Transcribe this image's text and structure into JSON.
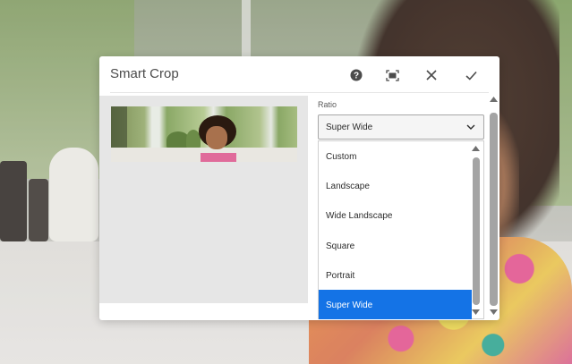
{
  "dialog": {
    "title": "Smart Crop",
    "header_buttons": [
      {
        "name": "help-icon"
      },
      {
        "name": "fit-to-screen-icon"
      },
      {
        "name": "close-icon"
      },
      {
        "name": "confirm-check-icon"
      }
    ]
  },
  "ratio": {
    "label": "Ratio",
    "selected": "Super Wide",
    "options": [
      "Custom",
      "Landscape",
      "Wide Landscape",
      "Square",
      "Portrait",
      "Super Wide"
    ]
  },
  "colors": {
    "accent": "#1473e6",
    "panel": "#e6e6e6",
    "scrollbar": "#a4a4a4"
  }
}
